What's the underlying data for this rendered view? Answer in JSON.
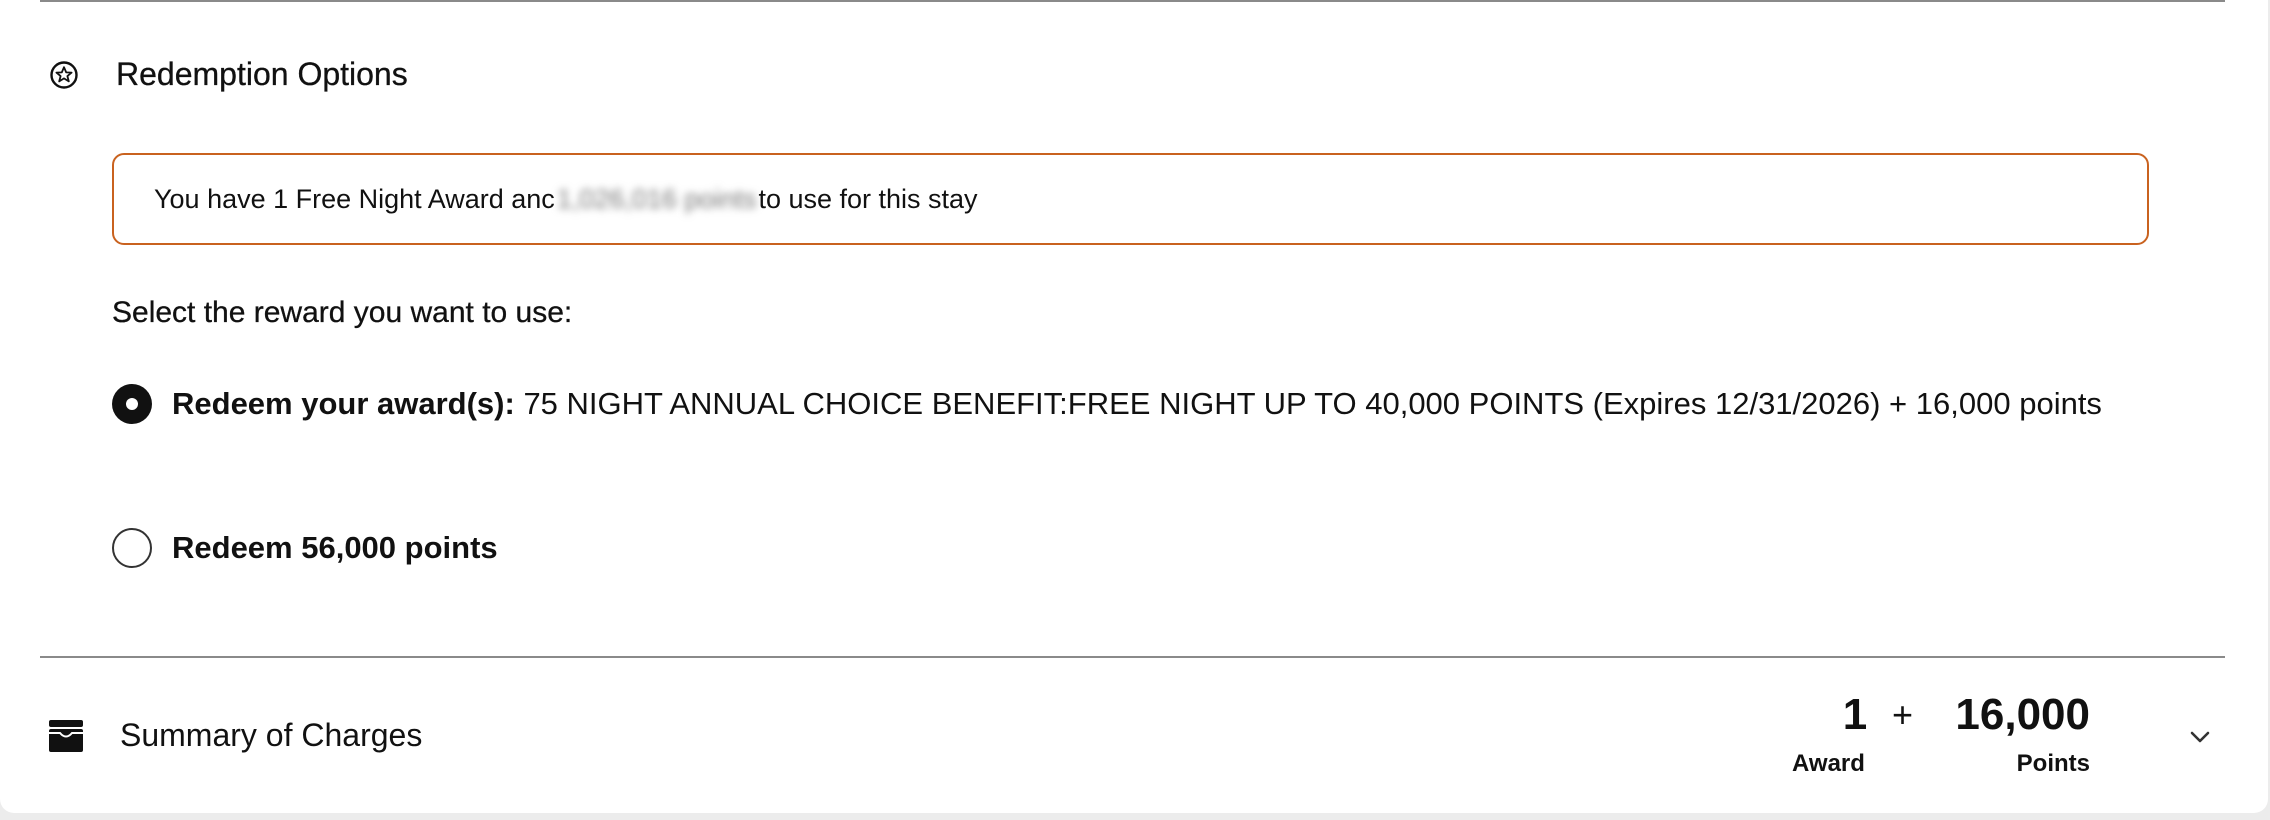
{
  "redemption": {
    "title": "Redemption Options",
    "notice": {
      "prefix": "You have 1 Free Night Award anc",
      "blurred": "1,026,016 points",
      "suffix": "to use for this stay"
    },
    "prompt": "Select the reward you want to use:",
    "options": [
      {
        "bold": "Redeem your award(s):",
        "text": " 75 NIGHT ANNUAL CHOICE BENEFIT:FREE NIGHT UP TO 40,000 POINTS (Expires 12/31/2026) + 16,000 points",
        "selected": true
      },
      {
        "label": "Redeem 56,000 points",
        "selected": false
      }
    ]
  },
  "summary": {
    "title": "Summary of Charges",
    "award_value": "1",
    "plus": "+",
    "points_value": "16,000",
    "award_label": "Award",
    "points_label": "Points"
  },
  "colors": {
    "notice_border": "#c9621f",
    "text": "#111111"
  },
  "icons": {
    "section": "star-circle-icon",
    "summary": "wallet-icon",
    "expand": "chevron-down-icon"
  }
}
